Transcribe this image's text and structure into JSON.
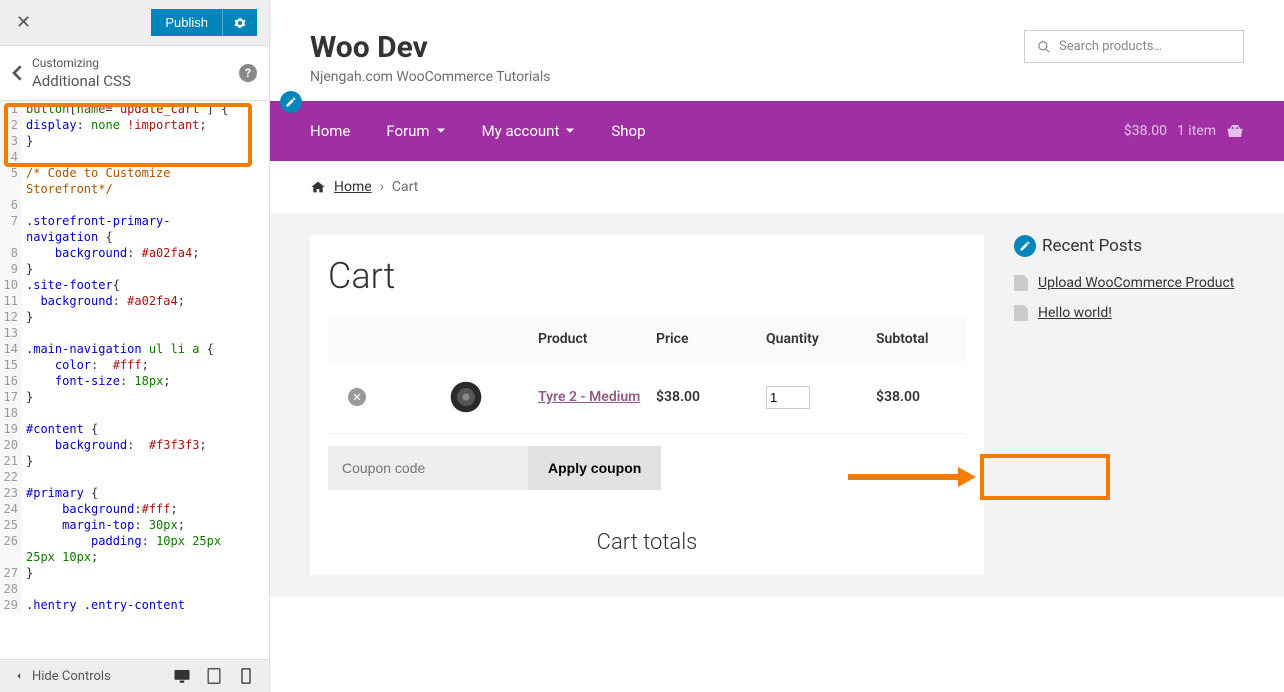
{
  "customizer": {
    "publish_label": "Publish",
    "customizing_label": "Customizing",
    "section_title": "Additional CSS",
    "hide_controls_label": "Hide Controls",
    "code_lines": [
      {
        "n": 1,
        "html": "<span class='tok-tag'>button</span>[<span class='tok-attr'>name</span>=<span class='tok-str'>'update_cart'</span>] {"
      },
      {
        "n": 2,
        "html": "<span class='tok-prop'>display</span>: <span class='tok-val'>none</span> <span class='tok-kw'>!important</span>;"
      },
      {
        "n": 3,
        "html": "}"
      },
      {
        "n": 4,
        "html": ""
      },
      {
        "n": 5,
        "html": "<span class='tok-comment'>/* Code to Customize Storefront*/</span>",
        "wrap": true,
        "rows": 2,
        "ns": [
          5,
          "",
          6
        ]
      },
      {
        "n": 6,
        "html": ""
      },
      {
        "n": 7,
        "html": "<span class='tok-sel'>.storefront-primary-navigation</span> {",
        "wrap": true,
        "rows": 2,
        "ns": [
          7,
          ""
        ]
      },
      {
        "n": 8,
        "html": "    <span class='tok-prop'>background</span>: <span class='tok-hex'>#a02fa4</span>;"
      },
      {
        "n": 9,
        "html": "}"
      },
      {
        "n": 10,
        "html": "<span class='tok-sel'>.site-footer</span>{"
      },
      {
        "n": 11,
        "html": "  <span class='tok-prop'>background</span>: <span class='tok-hex'>#a02fa4</span>;"
      },
      {
        "n": 12,
        "html": "}"
      },
      {
        "n": 13,
        "html": ""
      },
      {
        "n": 14,
        "html": "<span class='tok-sel'>.main-navigation</span> <span class='tok-tag'>ul</span> <span class='tok-tag'>li</span> <span class='tok-tag'>a</span> {"
      },
      {
        "n": 15,
        "html": "    <span class='tok-prop'>color</span>:  <span class='tok-hex'>#fff</span>;"
      },
      {
        "n": 16,
        "html": "    <span class='tok-prop'>font-size</span>: <span class='tok-val'>18px</span>;"
      },
      {
        "n": 17,
        "html": "}"
      },
      {
        "n": 18,
        "html": ""
      },
      {
        "n": 19,
        "html": "<span class='tok-sel'>#content</span> {"
      },
      {
        "n": 20,
        "html": "    <span class='tok-prop'>background</span>:  <span class='tok-hex'>#f3f3f3</span>;"
      },
      {
        "n": 21,
        "html": "}"
      },
      {
        "n": 22,
        "html": ""
      },
      {
        "n": 23,
        "html": "<span class='tok-sel'>#primary</span> {"
      },
      {
        "n": 24,
        "html": "     <span class='tok-prop'>background</span>:<span class='tok-hex'>#fff</span>;"
      },
      {
        "n": 25,
        "html": "     <span class='tok-prop'>margin-top</span>: <span class='tok-val'>30px</span>;"
      },
      {
        "n": 26,
        "html": "         <span class='tok-prop'>padding</span>: <span class='tok-val'>10px</span> <span class='tok-val'>25px</span> <span class='tok-val'>25px</span> <span class='tok-val'>10px</span>;",
        "wrap": true,
        "rows": 2,
        "ns": [
          26,
          ""
        ]
      },
      {
        "n": 27,
        "html": "}"
      },
      {
        "n": 28,
        "html": ""
      },
      {
        "n": 29,
        "html": "<span class='tok-sel'>.hentry</span> <span class='tok-sel'>.entry-content</span>"
      }
    ]
  },
  "site": {
    "title": "Woo Dev",
    "tagline": "Njengah.com WooCommerce Tutorials",
    "search_placeholder": "Search products…",
    "nav": {
      "home": "Home",
      "forum": "Forum",
      "account": "My account",
      "shop": "Shop"
    },
    "cart_summary": {
      "amount": "$38.00",
      "items": "1 item"
    },
    "breadcrumb": {
      "home": "Home",
      "current": "Cart"
    },
    "page_title": "Cart",
    "table": {
      "head": {
        "product": "Product",
        "price": "Price",
        "qty": "Quantity",
        "subtotal": "Subtotal"
      },
      "row": {
        "product_name": "Tyre 2 - Medium",
        "price": "$38.00",
        "qty": "1",
        "subtotal": "$38.00"
      }
    },
    "coupon": {
      "placeholder": "Coupon code",
      "apply": "Apply coupon"
    },
    "cart_totals_title": "Cart totals",
    "sidebar": {
      "widget_title": "Recent Posts",
      "posts": [
        "Upload WooCommerce Product",
        "Hello world!"
      ]
    }
  }
}
